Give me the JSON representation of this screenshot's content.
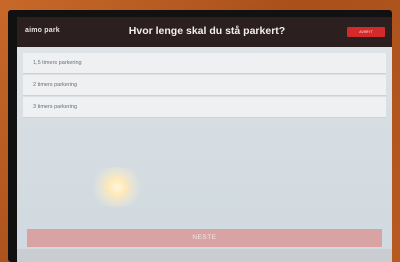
{
  "header": {
    "logo": "aimo park",
    "title": "Hvor lenge skal du stå parkert?",
    "cancel_label": "AVBRYT"
  },
  "options": [
    {
      "label": "1,5 timers parkering"
    },
    {
      "label": "2 timers parkering"
    },
    {
      "label": "3 timers parkering"
    }
  ],
  "footer": {
    "next_label": "NESTE"
  },
  "colors": {
    "topbar": "#2b1f20",
    "cancel_button": "#d42a2a",
    "next_button": "#d9a3a3"
  }
}
